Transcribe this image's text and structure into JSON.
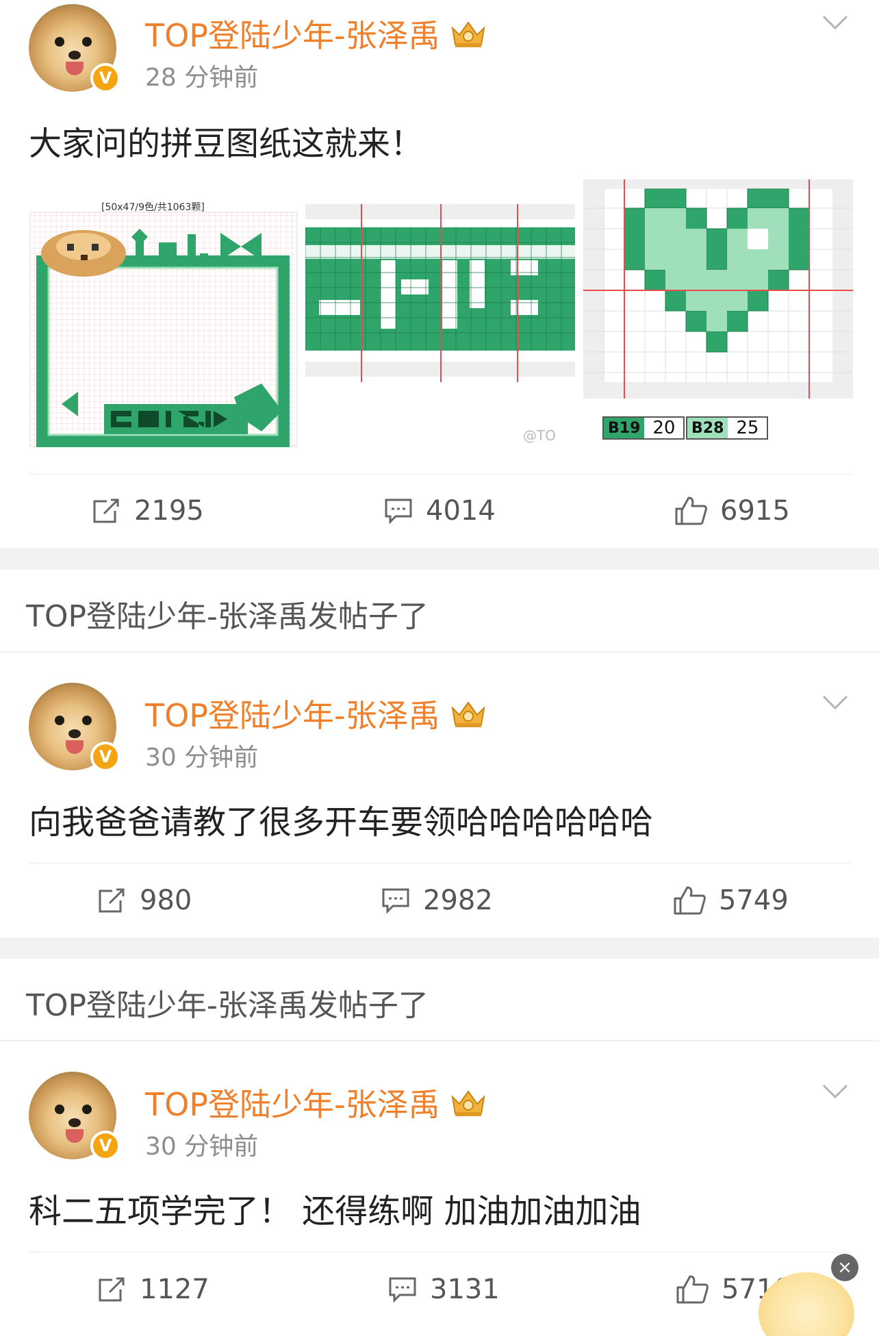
{
  "posts": [
    {
      "username": "TOP登陆少年-张泽禹",
      "time": "28 分钟前",
      "text": "大家问的拼豆图纸这就来！",
      "images": {
        "img1_caption": "[50x47/9色/共1063颗]",
        "img2_watermark": "@TO",
        "legend": [
          {
            "code": "B19",
            "count": "20"
          },
          {
            "code": "B28",
            "count": "25"
          }
        ]
      },
      "actions": {
        "repost": "2195",
        "comment": "4014",
        "like": "6915"
      }
    },
    {
      "username": "TOP登陆少年-张泽禹",
      "time": "30 分钟前",
      "text": "向我爸爸请教了很多开车要领哈哈哈哈哈哈",
      "actions": {
        "repost": "980",
        "comment": "2982",
        "like": "5749"
      }
    },
    {
      "username": "TOP登陆少年-张泽禹",
      "time": "30 分钟前",
      "text": "科二五项学完了！ 还得练啊 加油加油加油",
      "actions": {
        "repost": "1127",
        "comment": "3131",
        "like": "5710"
      }
    }
  ],
  "banners": [
    "TOP登陆少年-张泽禹发帖子了",
    "TOP登陆少年-张泽禹发帖子了"
  ],
  "badge_label": "V",
  "close_label": "×",
  "colors": {
    "username": "#f07f2a",
    "bead_green": "#2fa56b",
    "bead_light": "#9fe0bb",
    "badge": "#f6a512"
  },
  "icons": [
    "repost-icon",
    "comment-icon",
    "like-icon",
    "chevron-down-icon",
    "crown-icon",
    "verified-badge-icon",
    "close-icon"
  ]
}
